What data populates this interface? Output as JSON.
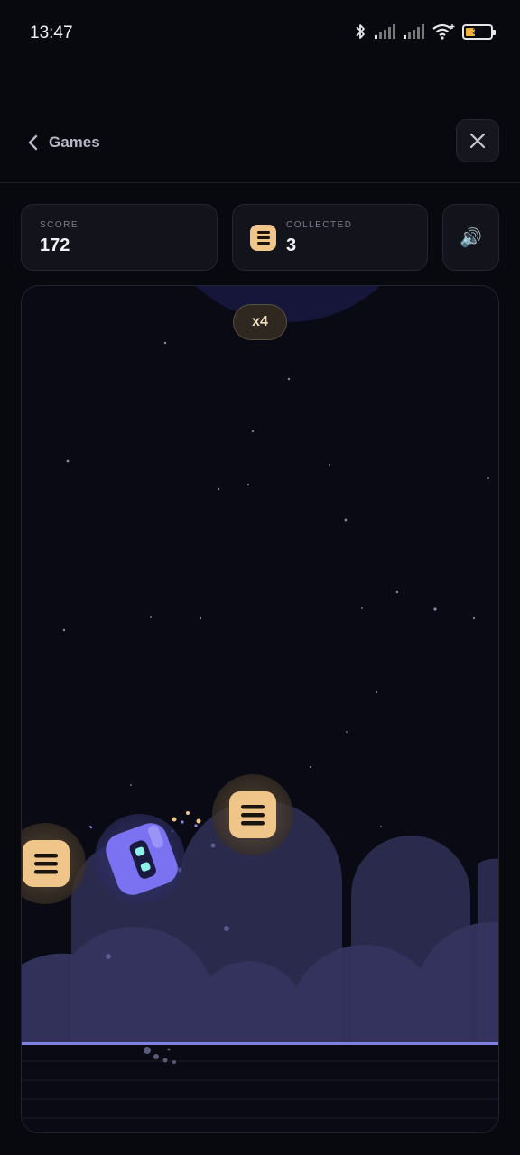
{
  "status_bar": {
    "time": "13:47",
    "battery_level": 39,
    "battery_text": "39",
    "icons": [
      "bluetooth-icon",
      "signal-icon",
      "signal-icon",
      "wifi-icon",
      "battery-icon"
    ]
  },
  "nav": {
    "back_label": "Games",
    "back_icon": "chevron-left-icon",
    "close_icon": "close-icon"
  },
  "stats": {
    "score_label": "SCORE",
    "score_value": "172",
    "collected_label": "COLLECTED",
    "collected_value": "3",
    "sound_icon": "🔊"
  },
  "game": {
    "multiplier": "x4",
    "player": "robot-block",
    "coins_on_screen": 2
  },
  "colors": {
    "background": "#08080f",
    "coin": "#efc58a",
    "player": "#7a72f0",
    "ground_line": "#8080e0",
    "hill": "#34345e"
  }
}
